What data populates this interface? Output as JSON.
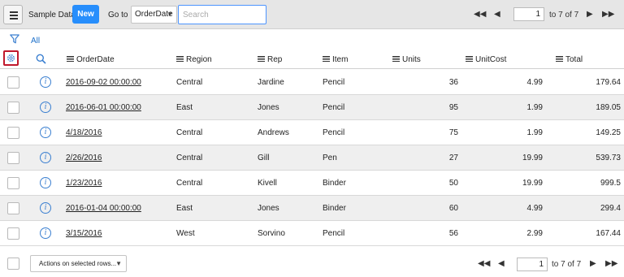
{
  "header": {
    "title": "Sample Data",
    "new_label": "New",
    "goto_label": "Go to",
    "goto_field": "OrderDate",
    "search_placeholder": "Search"
  },
  "pager": {
    "current_page": "1",
    "range_text": "to 7 of 7"
  },
  "filter": {
    "label": "All"
  },
  "columns": [
    "OrderDate",
    "Region",
    "Rep",
    "Item",
    "Units",
    "UnitCost",
    "Total"
  ],
  "rows": [
    {
      "OrderDate": "2016-09-02 00:00:00",
      "Region": "Central",
      "Rep": "Jardine",
      "Item": "Pencil",
      "Units": "36",
      "UnitCost": "4.99",
      "Total": "179.64"
    },
    {
      "OrderDate": "2016-06-01 00:00:00",
      "Region": "East",
      "Rep": "Jones",
      "Item": "Pencil",
      "Units": "95",
      "UnitCost": "1.99",
      "Total": "189.05"
    },
    {
      "OrderDate": "4/18/2016",
      "Region": "Central",
      "Rep": "Andrews",
      "Item": "Pencil",
      "Units": "75",
      "UnitCost": "1.99",
      "Total": "149.25"
    },
    {
      "OrderDate": "2/26/2016",
      "Region": "Central",
      "Rep": "Gill",
      "Item": "Pen",
      "Units": "27",
      "UnitCost": "19.99",
      "Total": "539.73"
    },
    {
      "OrderDate": "1/23/2016",
      "Region": "Central",
      "Rep": "Kivell",
      "Item": "Binder",
      "Units": "50",
      "UnitCost": "19.99",
      "Total": "999.5"
    },
    {
      "OrderDate": "2016-01-04 00:00:00",
      "Region": "East",
      "Rep": "Jones",
      "Item": "Binder",
      "Units": "60",
      "UnitCost": "4.99",
      "Total": "299.4"
    },
    {
      "OrderDate": "3/15/2016",
      "Region": "West",
      "Rep": "Sorvino",
      "Item": "Pencil",
      "Units": "56",
      "UnitCost": "2.99",
      "Total": "167.44"
    }
  ],
  "footer": {
    "actions_label": "Actions on selected rows...",
    "current_page": "1",
    "range_text": "to 7 of 7"
  },
  "colors": {
    "accent": "#278efc",
    "header_bg": "#e6e6e6",
    "alt_row_bg": "#efefef",
    "gear_highlight": "#c0182c",
    "info_icon": "#3a7fd0"
  },
  "icons": {
    "menu": "hamburger-icon",
    "first": "first-page-icon",
    "prev": "prev-page-icon",
    "next": "next-page-icon",
    "last": "last-page-icon",
    "filter": "filter-icon",
    "gear": "gear-icon",
    "search": "search-icon",
    "info": "info-icon",
    "column_menu": "column-menu-icon"
  }
}
